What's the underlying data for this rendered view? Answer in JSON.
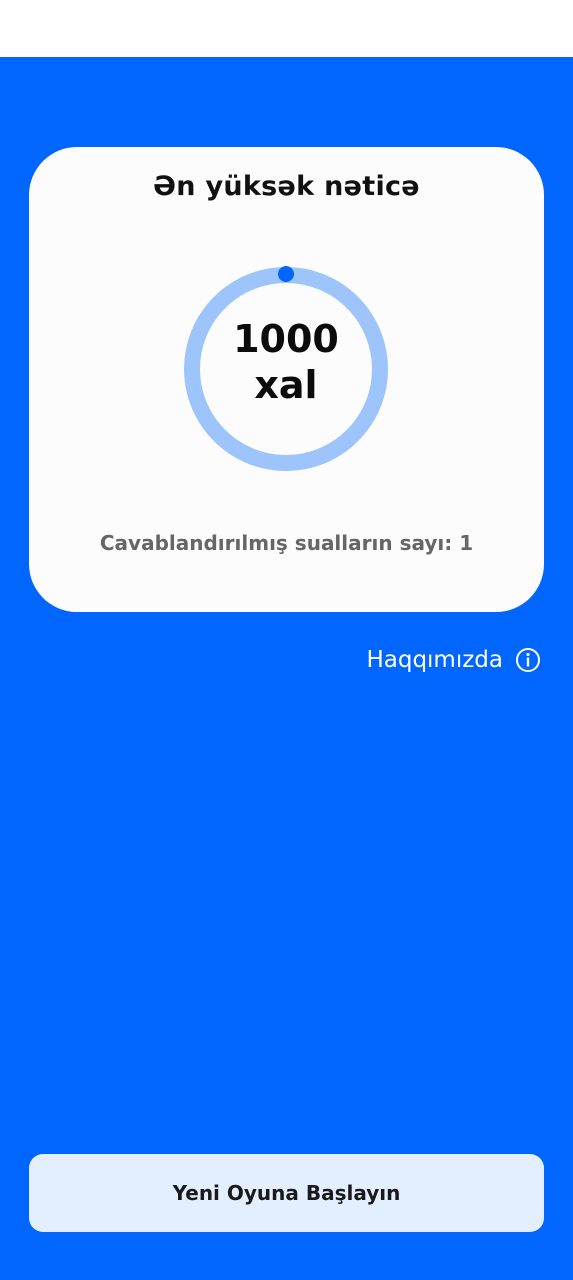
{
  "colors": {
    "background": "#0066fe",
    "card": "#fcfcfc",
    "ring_track": "#9ec5fb",
    "ring_progress": "#0066fe",
    "button_bg": "#e3efff"
  },
  "card": {
    "title": "Ən yüksək nəticə",
    "score_value": "1000",
    "score_unit": "xal",
    "answered_text": "Cavablandırılmış sualların sayı: 1"
  },
  "about": {
    "label": "Haqqımızda",
    "icon": "info-icon"
  },
  "start_button": {
    "label": "Yeni Oyuna Başlayın"
  }
}
